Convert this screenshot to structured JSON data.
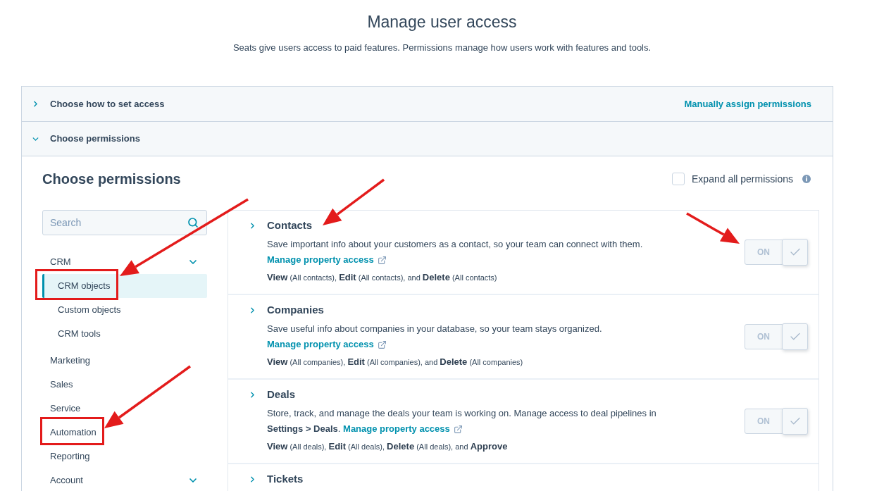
{
  "page": {
    "title": "Manage user access",
    "subtitle": "Seats give users access to paid features. Permissions manage how users work with features and tools."
  },
  "sections": [
    {
      "title": "Choose how to set access",
      "expanded": false,
      "value": "Manually assign permissions"
    },
    {
      "title": "Choose permissions",
      "expanded": true
    }
  ],
  "permissions_panel": {
    "heading": "Choose permissions",
    "expand_all": {
      "label": "Expand all permissions",
      "checked": false
    },
    "search": {
      "placeholder": "Search"
    },
    "nav": [
      {
        "label": "CRM",
        "expandable": true,
        "selected": false,
        "children": [
          {
            "label": "CRM objects",
            "selected": true
          },
          {
            "label": "Custom objects",
            "selected": false
          },
          {
            "label": "CRM tools",
            "selected": false
          }
        ]
      },
      {
        "label": "Marketing",
        "expandable": false,
        "selected": false
      },
      {
        "label": "Sales",
        "expandable": false,
        "selected": false
      },
      {
        "label": "Service",
        "expandable": false,
        "selected": false
      },
      {
        "label": "Automation",
        "expandable": false,
        "selected": false
      },
      {
        "label": "Reporting",
        "expandable": false,
        "selected": false
      },
      {
        "label": "Account",
        "expandable": true,
        "selected": false
      }
    ],
    "items": [
      {
        "title": "Contacts",
        "expanded": false,
        "description": "Save important info about your customers as a contact, so your team can connect with them.",
        "link": "Manage property access",
        "permissions": "**View** (All contacts), **Edit** (All contacts), and **Delete** (All contacts)",
        "toggle": {
          "label": "ON",
          "on": true
        }
      },
      {
        "title": "Companies",
        "expanded": false,
        "description": "Save useful info about companies in your database, so your team stays organized.",
        "link": "Manage property access",
        "permissions": "**View** (All companies), **Edit** (All companies), and **Delete** (All companies)",
        "toggle": {
          "label": "ON",
          "on": true
        }
      },
      {
        "title": "Deals",
        "expanded": false,
        "description": "Store, track, and manage the deals your team is working on. Manage access to deal pipelines in **Settings > Deals**.",
        "link": "Manage property access",
        "permissions": "**View** (All deals), **Edit** (All deals), **Delete** (All deals), and **Approve**",
        "toggle": {
          "label": "ON",
          "on": true
        }
      },
      {
        "title": "Tickets",
        "expanded": false
      }
    ]
  }
}
